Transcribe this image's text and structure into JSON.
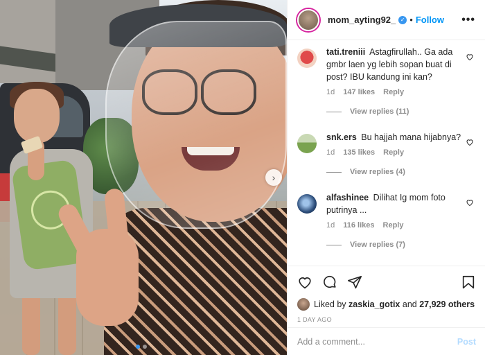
{
  "post": {
    "username": "mom_ayting92_",
    "separator": "•",
    "follow_label": "Follow",
    "more_label": "•••",
    "next_glyph": "›"
  },
  "comments": [
    {
      "username": "tati.treniii",
      "text": "Astagfirullah.. Ga ada gmbr laen yg lebih sopan buat di post? IBU kandung ini kan?",
      "time": "1d",
      "likes": "147 likes",
      "reply_label": "Reply",
      "view_replies": "View replies (11)",
      "avatar_color": "#e04a4a"
    },
    {
      "username": "snk.ers",
      "text": "Bu hajjah mana hijabnya?",
      "time": "1d",
      "likes": "135 likes",
      "reply_label": "Reply",
      "view_replies": "View replies (4)",
      "avatar_color": "#7aa34f"
    },
    {
      "username": "alfashinee",
      "text": "Dilihat Ig mom foto putrinya ...",
      "time": "1d",
      "likes": "116 likes",
      "reply_label": "Reply",
      "view_replies": "View replies (7)",
      "avatar_color": "#2c4d7a"
    }
  ],
  "likes_line": {
    "prefix": "Liked by",
    "user": "zaskia_gotix",
    "middle": "and",
    "count": "27,929 others"
  },
  "timestamp": "1 DAY AGO",
  "add_comment": {
    "placeholder": "Add a comment...",
    "post_label": "Post"
  },
  "icons": [
    "heart-icon",
    "comment-icon",
    "share-icon",
    "bookmark-icon",
    "verified-icon",
    "more-icon",
    "chevron-right-icon"
  ],
  "colors": {
    "accent": "#0095f6",
    "verified": "#3897f0",
    "post_disabled": "#b3dbff",
    "muted": "#8e8e8e"
  }
}
